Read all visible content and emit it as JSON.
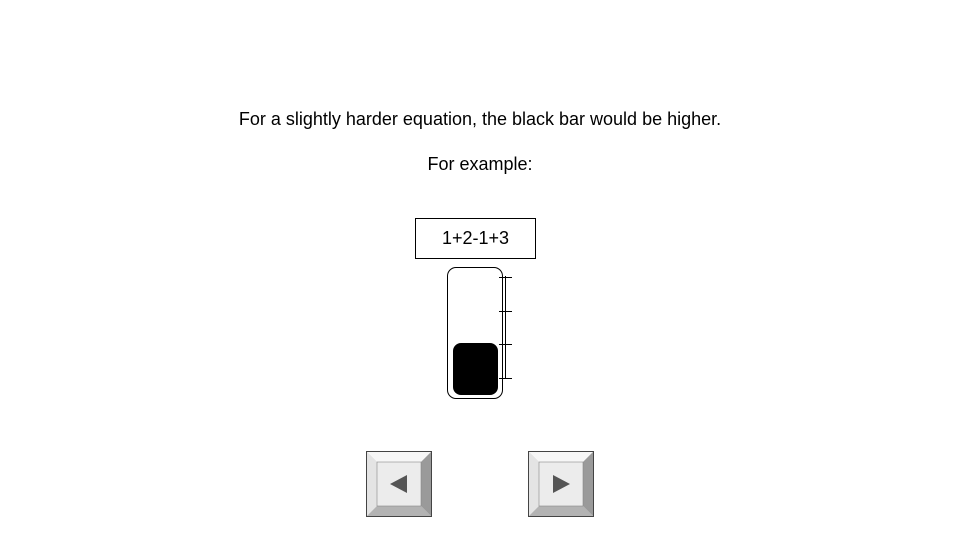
{
  "instructions": {
    "line1": "For a slightly harder equation, the black bar would be higher.",
    "line2": "For example:"
  },
  "equation": {
    "text": "1+2-1+3"
  },
  "difficulty_meter": {
    "level_fraction": 0.4,
    "tick_count": 4,
    "fill_color": "#000000"
  },
  "navigation": {
    "prev_icon": "left-arrow-icon",
    "next_icon": "right-arrow-icon",
    "button_face_color": "#ececec",
    "arrow_color": "#555555"
  }
}
